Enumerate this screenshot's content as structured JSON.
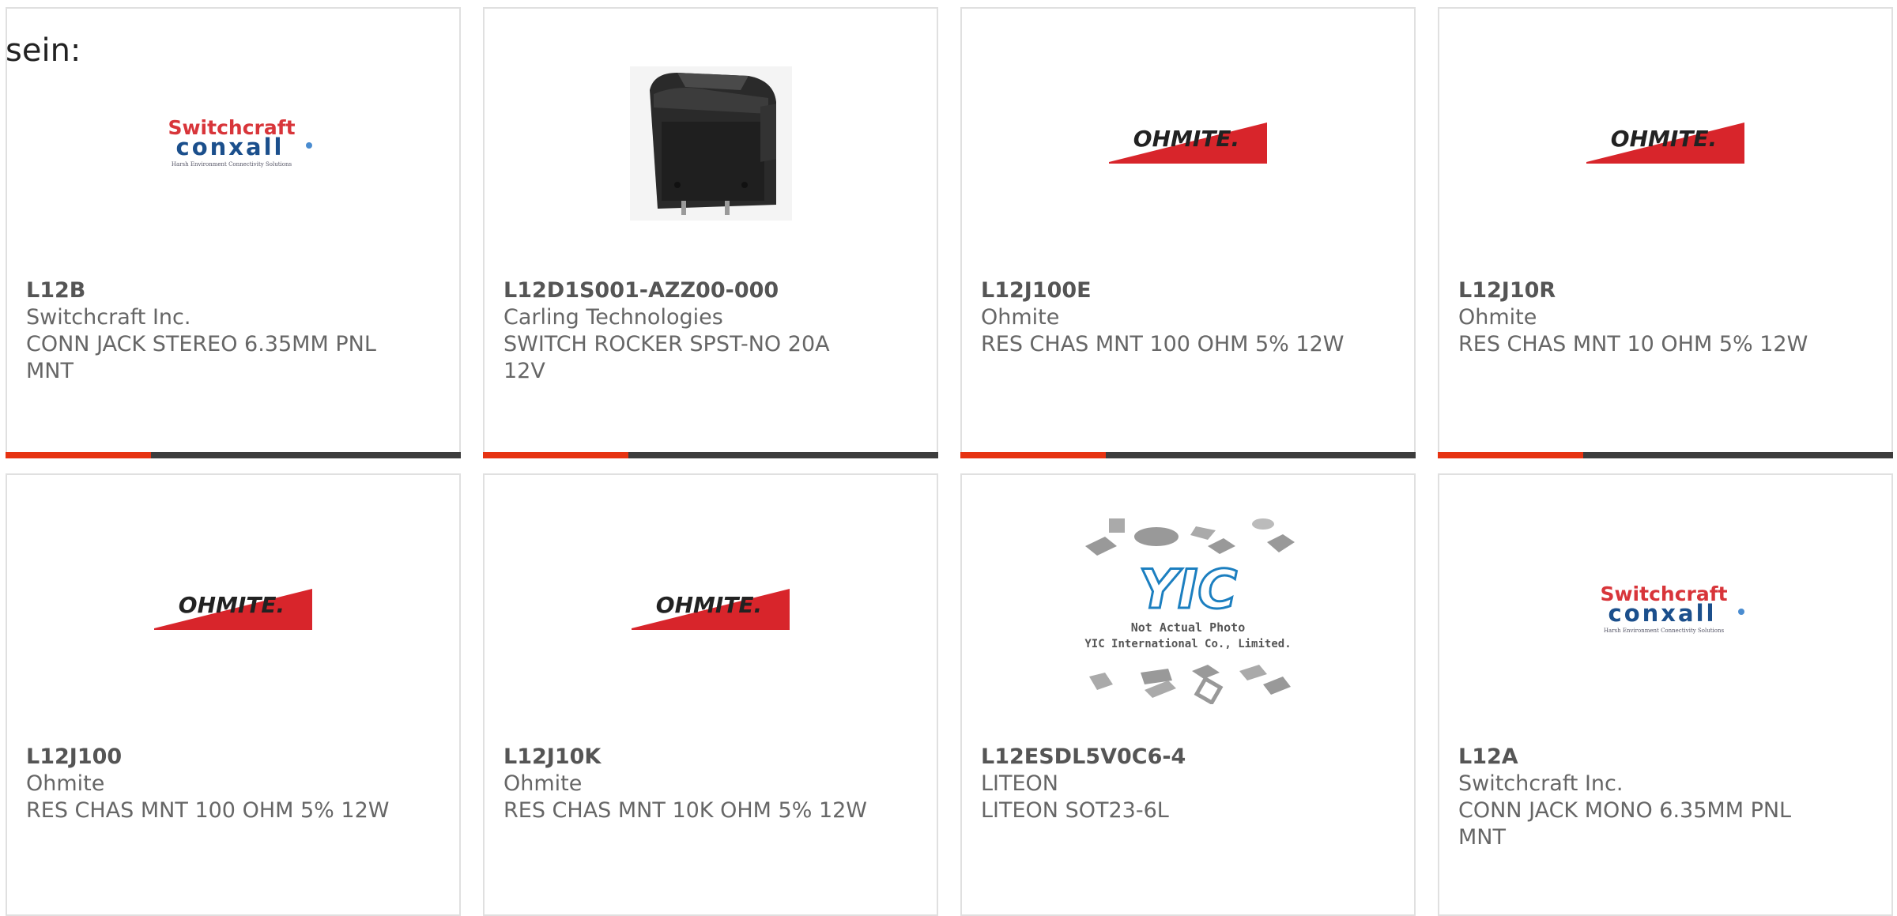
{
  "heading": "sein:",
  "colors": {
    "accent": "#e63312",
    "bar": "#3d3d3d",
    "border": "#e0e0e0"
  },
  "products": [
    {
      "part": "L12B",
      "manufacturer": "Switchcraft Inc.",
      "description": "CONN JACK STEREO 6.35MM PNL MNT",
      "image": "switchcraft-conxall-logo"
    },
    {
      "part": "L12D1S001-AZZ00-000",
      "manufacturer": "Carling Technologies",
      "description": "SWITCH ROCKER SPST-NO 20A 12V",
      "image": "rocker-switch-photo"
    },
    {
      "part": "L12J100E",
      "manufacturer": "Ohmite",
      "description": "RES CHAS MNT 100 OHM 5% 12W",
      "image": "ohmite-logo"
    },
    {
      "part": "L12J10R",
      "manufacturer": "Ohmite",
      "description": "RES CHAS MNT 10 OHM 5% 12W",
      "image": "ohmite-logo"
    },
    {
      "part": "L12J100",
      "manufacturer": "Ohmite",
      "description": "RES CHAS MNT 100 OHM 5% 12W",
      "image": "ohmite-logo"
    },
    {
      "part": "L12J10K",
      "manufacturer": "Ohmite",
      "description": "RES CHAS MNT 10K OHM 5% 12W",
      "image": "ohmite-logo"
    },
    {
      "part": "L12ESDL5V0C6-4",
      "manufacturer": "LITEON",
      "description": "LITEON SOT23-6L",
      "image": "yic-placeholder",
      "image_caption_1": "Not Actual Photo",
      "image_caption_2": "YIC International Co., Limited.",
      "image_logo_text": "YIC"
    },
    {
      "part": "L12A",
      "manufacturer": "Switchcraft Inc.",
      "description": "CONN JACK MONO 6.35MM PNL MNT",
      "image": "switchcraft-conxall-logo"
    }
  ],
  "logos": {
    "ohmite": "OHMITE.",
    "switchcraft": "Switchcraft",
    "conxall": "conxall",
    "conxall_tagline": "Harsh Environment Connectivity Solutions"
  }
}
